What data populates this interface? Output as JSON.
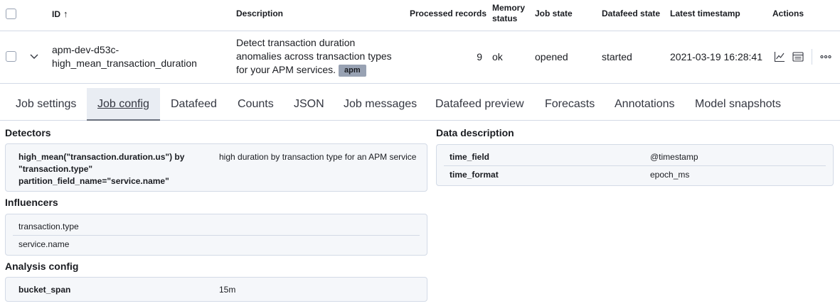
{
  "table": {
    "headers": {
      "id": "ID",
      "description": "Description",
      "processed_records": "Processed records",
      "memory_status": "Memory status",
      "job_state": "Job state",
      "datafeed_state": "Datafeed state",
      "latest_timestamp": "Latest timestamp",
      "actions": "Actions"
    },
    "row": {
      "id_line1": "apm-dev-d53c-",
      "id_line2": "high_mean_transaction_duration",
      "desc_line1": "Detect transaction duration",
      "desc_line2": "anomalies across transaction types",
      "desc_line3": "for your APM services.",
      "badge": "apm",
      "processed_records": "9",
      "memory_status": "ok",
      "job_state": "opened",
      "datafeed_state": "started",
      "latest_timestamp": "2021-03-19 16:28:41"
    }
  },
  "tabs": [
    {
      "label": "Job settings",
      "active": false
    },
    {
      "label": "Job config",
      "active": true
    },
    {
      "label": "Datafeed",
      "active": false
    },
    {
      "label": "Counts",
      "active": false
    },
    {
      "label": "JSON",
      "active": false
    },
    {
      "label": "Job messages",
      "active": false
    },
    {
      "label": "Datafeed preview",
      "active": false
    },
    {
      "label": "Forecasts",
      "active": false
    },
    {
      "label": "Annotations",
      "active": false
    },
    {
      "label": "Model snapshots",
      "active": false
    }
  ],
  "detectors": {
    "title": "Detectors",
    "key_line1": "high_mean(\"transaction.duration.us\") by",
    "key_line2": "\"transaction.type\"",
    "key_line3": "partition_field_name=\"service.name\"",
    "value": "high duration by transaction type for an APM service"
  },
  "influencers": {
    "title": "Influencers",
    "items": [
      "transaction.type",
      "service.name"
    ]
  },
  "analysis_config": {
    "title": "Analysis config",
    "key": "bucket_span",
    "value": "15m"
  },
  "data_description": {
    "title": "Data description",
    "rows": [
      {
        "key": "time_field",
        "value": "@timestamp"
      },
      {
        "key": "time_format",
        "value": "epoch_ms"
      }
    ]
  },
  "icons": {
    "sort": "arrow-up-icon",
    "expand": "chevron-down-icon",
    "actions": [
      "anomaly-explorer-icon",
      "single-metric-viewer-icon",
      "more-actions-icon"
    ]
  },
  "colors": {
    "border": "#d3dae6",
    "panel_bg": "#f5f7fa",
    "badge_bg": "#98a2b3",
    "active_tab_bg": "#e9edf3"
  }
}
